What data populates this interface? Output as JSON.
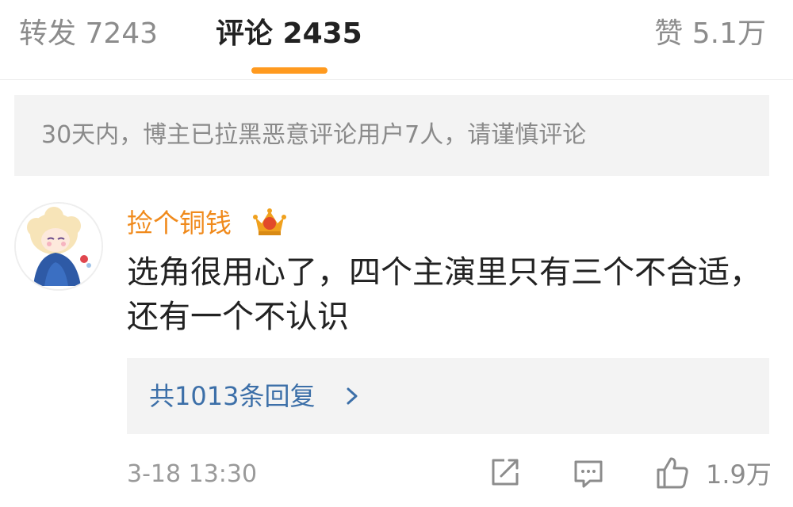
{
  "tabs": {
    "repost": "转发 7243",
    "comment": "评论 2435",
    "like": "赞 5.1万"
  },
  "notice": "30天内，博主已拉黑恶意评论用户7人，请谨慎评论",
  "comment": {
    "username": "捡个铜钱",
    "badge_icon": "crown-badge-icon",
    "text": "选角很用心了，四个主演里只有三个不合适，还有一个不认识",
    "replies_label": "共1013条回复",
    "timestamp": "3-18 13:30",
    "like_count": "1.9万"
  },
  "colors": {
    "accent": "#ff9a1f",
    "username": "#f08a1c",
    "link": "#3c6fa8"
  }
}
